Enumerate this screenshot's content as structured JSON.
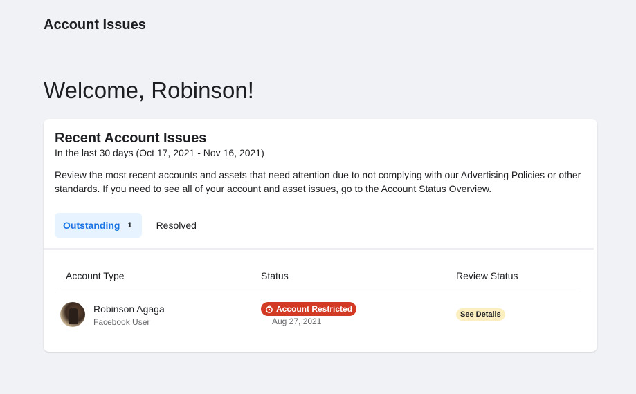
{
  "header": {
    "title": "Account Issues"
  },
  "welcome": "Welcome, Robinson!",
  "card": {
    "title": "Recent Account Issues",
    "range": "In the last 30 days (Oct 17, 2021 - Nov 16, 2021)",
    "description": "Review the most recent accounts and assets that need attention due to not complying with our Advertising Policies or other standards. If you need to see all of your account and asset issues, go to the Account Status Overview.",
    "tabs": [
      {
        "label": "Outstanding",
        "count": "1",
        "active": true
      },
      {
        "label": "Resolved",
        "active": false
      }
    ]
  },
  "table": {
    "headers": [
      "Account Type",
      "Status",
      "Review Status"
    ],
    "rows": [
      {
        "name": "Robinson Agaga",
        "subtitle": "Facebook User",
        "status": "Account Restricted",
        "status_date": "Aug 27, 2021",
        "review": "See Details"
      }
    ]
  },
  "colors": {
    "accent": "#1b74e4",
    "tab_active_bg": "#e7f3ff",
    "restricted": "#d23a24",
    "details_bg": "#fbeec0"
  }
}
